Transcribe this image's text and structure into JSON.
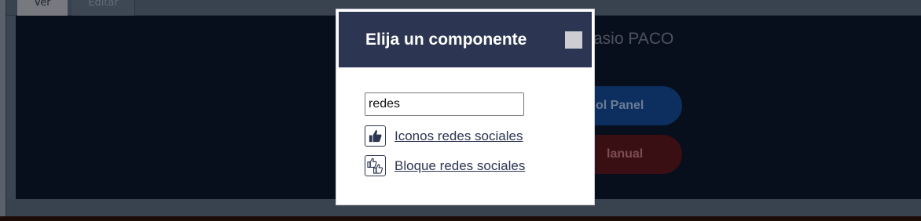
{
  "tabs": [
    {
      "label": "Ver",
      "active": true
    },
    {
      "label": "Editar",
      "active": false
    }
  ],
  "background": {
    "page_title_fragment": "asio PACO",
    "button_panel_label": "ol Panel",
    "button_manual_label": "lanual"
  },
  "modal": {
    "title": "Elija un componente",
    "search": {
      "value": "redes",
      "placeholder": ""
    },
    "results": [
      {
        "label": "Iconos redes sociales",
        "icon": "thumbs-up-icon"
      },
      {
        "label": "Bloque redes sociales",
        "icon": "double-thumbs-up-icon"
      }
    ]
  },
  "colors": {
    "modal_header": "#2c3552",
    "panel_button": "#0c2f60",
    "manual_button": "#3a0f14",
    "content_background": "#080f1c"
  }
}
